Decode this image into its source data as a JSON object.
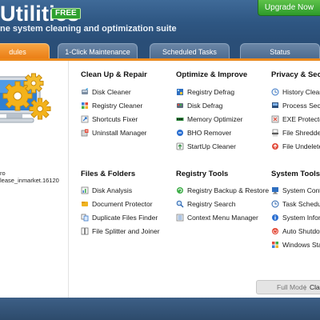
{
  "header": {
    "title": "Utilities",
    "badge": "FREE",
    "subtitle": "ne system cleaning and optimization suite",
    "upgrade_label": "Upgrade Now"
  },
  "tabs": [
    {
      "label": "dules",
      "active": true
    },
    {
      "label": "1-Click Maintenance",
      "active": false
    },
    {
      "label": "Scheduled Tasks",
      "active": false
    },
    {
      "label": "Status",
      "active": false
    }
  ],
  "left_pane": {
    "caption_line1": "ro",
    "caption_line2": "lease_inmarket.16120"
  },
  "sections": [
    {
      "title": "Clean Up & Repair",
      "items": [
        {
          "label": "Disk Cleaner",
          "icon": "disk-cleaner-icon"
        },
        {
          "label": "Registry Cleaner",
          "icon": "registry-cleaner-icon"
        },
        {
          "label": "Shortcuts Fixer",
          "icon": "shortcuts-fixer-icon"
        },
        {
          "label": "Uninstall Manager",
          "icon": "uninstall-manager-icon"
        }
      ]
    },
    {
      "title": "Optimize & Improve",
      "items": [
        {
          "label": "Registry Defrag",
          "icon": "registry-defrag-icon"
        },
        {
          "label": "Disk Defrag",
          "icon": "disk-defrag-icon"
        },
        {
          "label": "Memory Optimizer",
          "icon": "memory-optimizer-icon"
        },
        {
          "label": "BHO Remover",
          "icon": "bho-remover-icon"
        },
        {
          "label": "StartUp Cleaner",
          "icon": "startup-cleaner-icon"
        }
      ]
    },
    {
      "title": "Privacy & Secu",
      "items": [
        {
          "label": "History Clean",
          "icon": "history-cleaner-icon"
        },
        {
          "label": "Process Secur",
          "icon": "process-security-icon"
        },
        {
          "label": "EXE Protector",
          "icon": "exe-protector-icon"
        },
        {
          "label": "File Shredder",
          "icon": "file-shredder-icon"
        },
        {
          "label": "File Undelete",
          "icon": "file-undelete-icon"
        }
      ]
    },
    {
      "title": "Files & Folders",
      "items": [
        {
          "label": "Disk Analysis",
          "icon": "disk-analysis-icon"
        },
        {
          "label": "Document Protector",
          "icon": "document-protector-icon"
        },
        {
          "label": "Duplicate Files Finder",
          "icon": "duplicate-files-icon"
        },
        {
          "label": "File Splitter and Joiner",
          "icon": "file-splitter-icon"
        }
      ]
    },
    {
      "title": "Registry Tools",
      "items": [
        {
          "label": "Registry Backup & Restore",
          "icon": "registry-backup-icon"
        },
        {
          "label": "Registry Search",
          "icon": "registry-search-icon"
        },
        {
          "label": "Context Menu Manager",
          "icon": "context-menu-icon"
        }
      ]
    },
    {
      "title": "System Tools",
      "items": [
        {
          "label": "System Contr",
          "icon": "system-control-icon"
        },
        {
          "label": "Task Schedul",
          "icon": "task-scheduler-icon"
        },
        {
          "label": "System Inforn",
          "icon": "system-information-icon"
        },
        {
          "label": "Auto Shutdov",
          "icon": "auto-shutdown-icon"
        },
        {
          "label": "Windows Star",
          "icon": "windows-startup-icon"
        }
      ]
    }
  ],
  "mode": {
    "full_label": "Full Mode",
    "separator": "|",
    "classic_label": "Clas"
  },
  "colors": {
    "header_blue": "#2e5682",
    "accent_orange": "#ec8a1d",
    "upgrade_green": "#2d9a2a"
  }
}
